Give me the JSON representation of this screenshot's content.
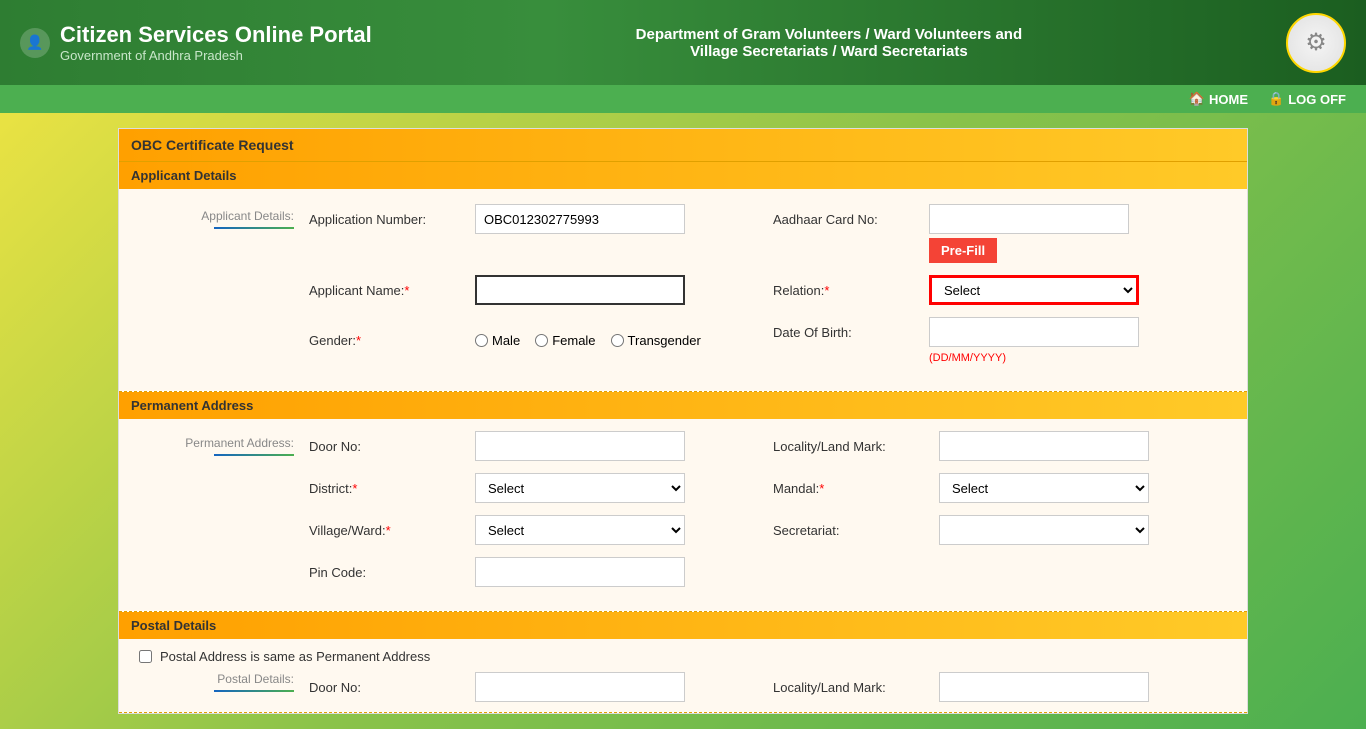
{
  "header": {
    "title": "Citizen Services Online Portal",
    "subtitle": "Government of Andhra Pradesh",
    "dept_line1": "Department of Gram Volunteers / Ward Volunteers and",
    "dept_line2": "Village Secretariats / Ward Secretariats"
  },
  "navbar": {
    "home_label": "HOME",
    "logoff_label": "LOG OFF"
  },
  "page_title": "OBC Certificate Request",
  "applicant_section": {
    "label": "Applicant Details",
    "sub_label": "Applicant Details:",
    "app_number_label": "Application Number:",
    "app_number_value": "OBC012302775993",
    "aadhaar_label": "Aadhaar Card No:",
    "prefill_label": "Pre-Fill",
    "applicant_name_label": "Applicant Name:",
    "applicant_name_placeholder": "",
    "relation_label": "Relation:",
    "gender_label": "Gender:",
    "gender_options": [
      "Male",
      "Female",
      "Transgender"
    ],
    "dob_label": "Date Of Birth:",
    "dob_hint": "(DD/MM/YYYY)",
    "relation_select_default": "Select"
  },
  "permanent_address": {
    "section_label": "Permanent Address",
    "sub_label": "Permanent Address:",
    "door_no_label": "Door No:",
    "locality_label": "Locality/Land Mark:",
    "district_label": "District:",
    "mandal_label": "Mandal:",
    "village_ward_label": "Village/Ward:",
    "secretariat_label": "Secretariat:",
    "pincode_label": "Pin Code:",
    "select_default": "Select"
  },
  "postal_details": {
    "section_label": "Postal Details",
    "same_as_permanent": "Postal Address is same as Permanent Address",
    "sub_label": "Postal Details:",
    "door_no_label": "Door No:",
    "locality_label": "Locality/Land Mark:"
  },
  "icons": {
    "home": "🏠",
    "lock": "🔒",
    "person": "👤",
    "logo": "⚙"
  }
}
